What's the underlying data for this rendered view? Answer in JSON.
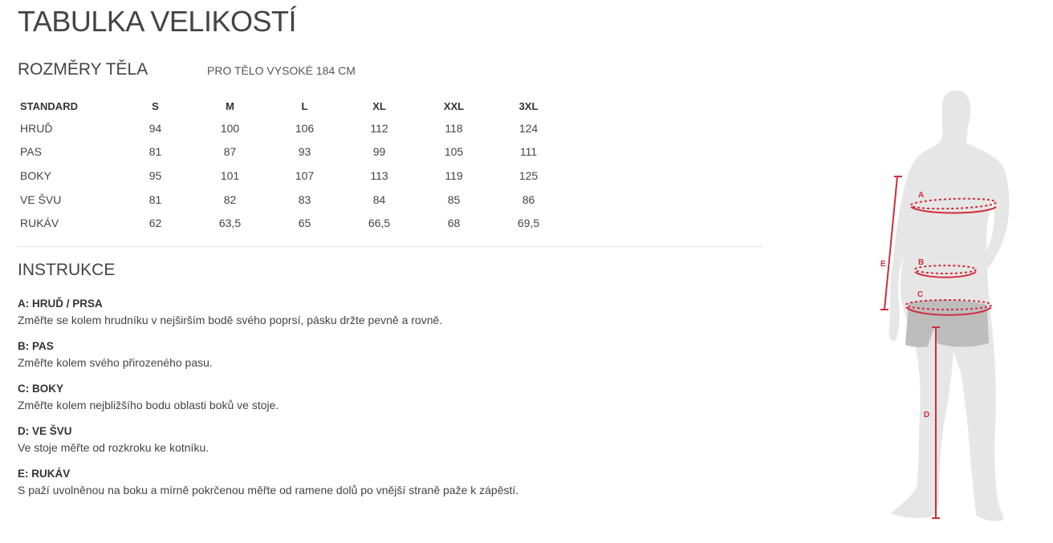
{
  "page_title": "TABULKA VELIKOSTÍ",
  "body_section": {
    "title": "ROZMĚRY TĚLA",
    "note": "PRO TĚLO VYSOKÉ 184 CM"
  },
  "size_table": {
    "headers": [
      "STANDARD",
      "S",
      "M",
      "L",
      "XL",
      "XXL",
      "3XL"
    ],
    "rows": [
      {
        "label": "HRUĎ",
        "values": [
          "94",
          "100",
          "106",
          "112",
          "118",
          "124"
        ]
      },
      {
        "label": "PAS",
        "values": [
          "81",
          "87",
          "93",
          "99",
          "105",
          "111"
        ]
      },
      {
        "label": "BOKY",
        "values": [
          "95",
          "101",
          "107",
          "113",
          "119",
          "125"
        ]
      },
      {
        "label": "VE ŠVU",
        "values": [
          "81",
          "82",
          "83",
          "84",
          "85",
          "86"
        ]
      },
      {
        "label": "RUKÁV",
        "values": [
          "62",
          "63,5",
          "65",
          "66,5",
          "68",
          "69,5"
        ]
      }
    ]
  },
  "instructions": {
    "title": "INSTRUKCE",
    "items": [
      {
        "heading": "A: HRUĎ / PRSA",
        "text": "Změřte se kolem hrudníku v nejširším bodě svého poprsí, pásku držte pevně a rovně."
      },
      {
        "heading": "B: PAS",
        "text": "Změřte kolem svého přirozeného pasu."
      },
      {
        "heading": "C: BOKY",
        "text": "Změřte kolem nejbližšího bodu oblasti boků ve stoje."
      },
      {
        "heading": "D: VE ŠVU",
        "text": "Ve stoje měřte od rozkroku ke kotníku."
      },
      {
        "heading": "E: RUKÁV",
        "text": "S paží uvolněnou na boku a mírně pokrčenou měřte od ramene dolů po vnější straně paže k zápěstí."
      }
    ]
  },
  "figure": {
    "labels": {
      "a": "A",
      "b": "B",
      "c": "C",
      "d": "D",
      "e": "E"
    },
    "colors": {
      "body": "#e6e6e6",
      "shorts": "#bdbdbd",
      "measure": "#d22c3c"
    }
  }
}
